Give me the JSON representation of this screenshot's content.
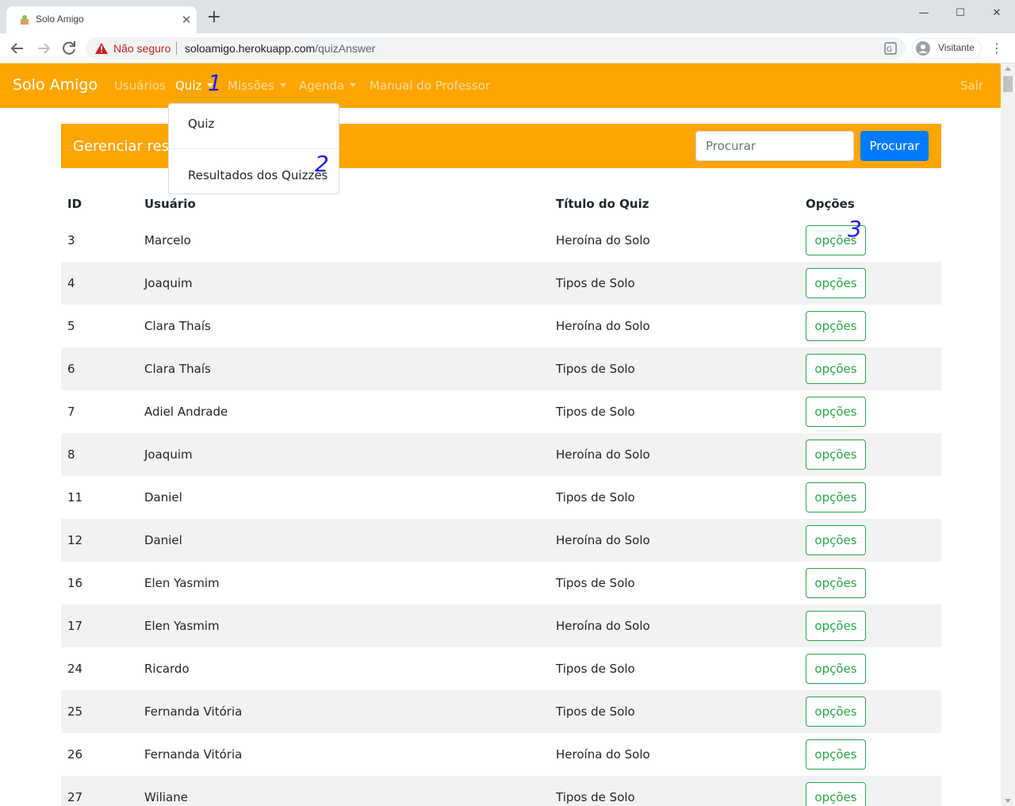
{
  "browser": {
    "tab_title": "Solo Amigo",
    "new_tab": "+",
    "not_secure": "Não seguro",
    "url_host": "soloamigo.herokuapp.com",
    "url_path": "/quizAnswer",
    "profile": "Visitante"
  },
  "navbar": {
    "brand": "Solo Amigo",
    "links": [
      "Usuários",
      "Quiz",
      "Missões",
      "Agenda",
      "Manual do Professor"
    ],
    "logout": "Sair"
  },
  "dropdown": {
    "items": [
      "Quiz",
      "Resultados dos Quizzes"
    ]
  },
  "header": {
    "title": "Gerenciar resultados dos quizzes",
    "search_placeholder": "Procurar",
    "search_button": "Procurar"
  },
  "table": {
    "columns": [
      "ID",
      "Usuário",
      "Título do Quiz",
      "Opções"
    ],
    "option_label": "opções",
    "rows": [
      {
        "id": "3",
        "user": "Marcelo",
        "quiz": "Heroína do Solo"
      },
      {
        "id": "4",
        "user": "Joaquim",
        "quiz": "Tipos de Solo"
      },
      {
        "id": "5",
        "user": "Clara Thaís",
        "quiz": "Heroína do Solo"
      },
      {
        "id": "6",
        "user": "Clara Thaís",
        "quiz": "Tipos de Solo"
      },
      {
        "id": "7",
        "user": "Adiel Andrade",
        "quiz": "Tipos de Solo"
      },
      {
        "id": "8",
        "user": "Joaquim",
        "quiz": "Heroína do Solo"
      },
      {
        "id": "11",
        "user": "Daniel",
        "quiz": "Tipos de Solo"
      },
      {
        "id": "12",
        "user": "Daniel",
        "quiz": "Heroína do Solo"
      },
      {
        "id": "16",
        "user": "Elen Yasmim",
        "quiz": "Tipos de Solo"
      },
      {
        "id": "17",
        "user": "Elen Yasmim",
        "quiz": "Heroína do Solo"
      },
      {
        "id": "24",
        "user": "Ricardo",
        "quiz": "Tipos de Solo"
      },
      {
        "id": "25",
        "user": "Fernanda Vitória",
        "quiz": "Tipos de Solo"
      },
      {
        "id": "26",
        "user": "Fernanda Vitória",
        "quiz": "Heroína do Solo"
      },
      {
        "id": "27",
        "user": "Wiliane",
        "quiz": "Tipos de Solo"
      }
    ]
  },
  "annotations": [
    "1",
    "2",
    "3"
  ],
  "colors": {
    "navbar": "#ffa500",
    "primary_button": "#007bff",
    "options_button": "#28a745",
    "annotation": "#1a1aff"
  }
}
